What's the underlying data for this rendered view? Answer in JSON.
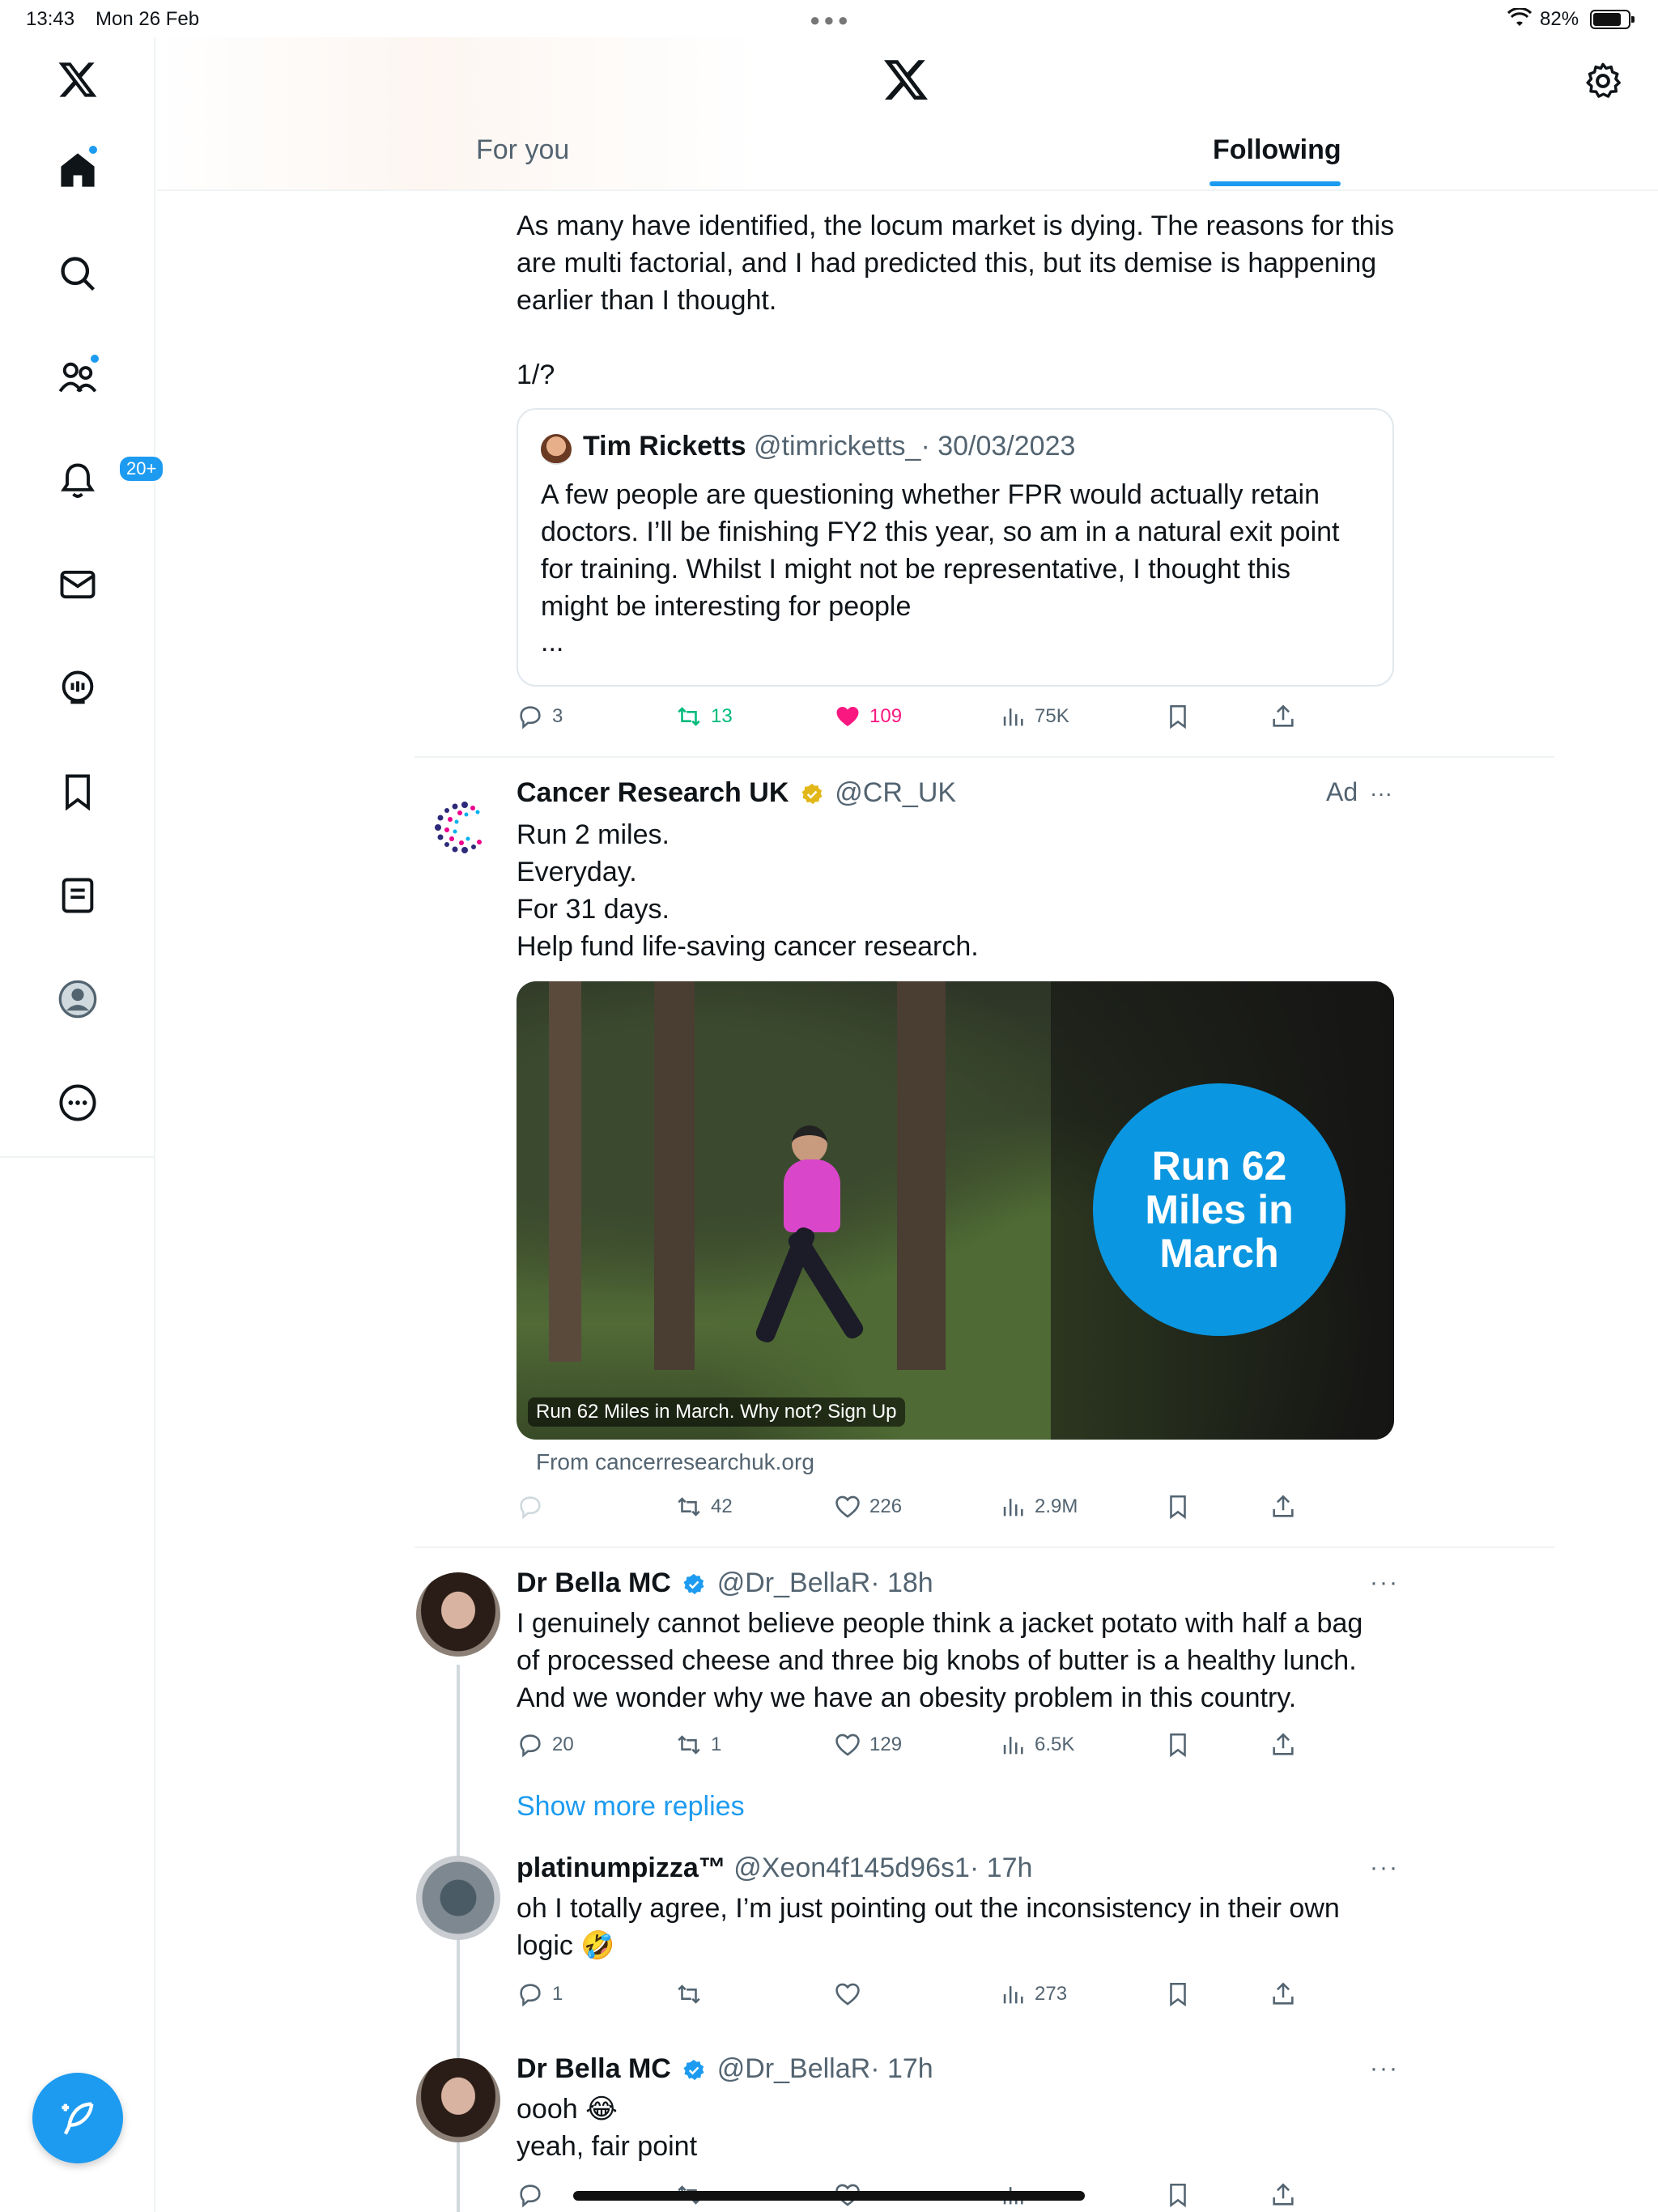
{
  "status_bar": {
    "time": "13:43",
    "date": "Mon 26 Feb",
    "battery": "82%",
    "battery_level": 0.82
  },
  "header": {
    "tabs": [
      {
        "label": "For you"
      },
      {
        "label": "Following"
      }
    ]
  },
  "sidebar": {
    "notifications_badge": "20+"
  },
  "post1": {
    "text": "As many have identified, the locum market is dying. The reasons for this\nare multi factorial, and I had predicted this, but its demise is happening\nearlier than I thought.",
    "thread_counter": "1/?",
    "quote": {
      "name": "Tim Ricketts",
      "handle": "@timricketts_",
      "date": "· 30/03/2023",
      "text": "A few people are questioning whether FPR would actually retain\ndoctors. I’ll be finishing FY2 this year, so am in a natural exit point\nfor training. Whilst I might not be representative, I thought this\nmight be interesting for people",
      "ellipsis": "..."
    },
    "stats": {
      "replies": "3",
      "reposts": "13",
      "likes": "109",
      "views": "75K"
    }
  },
  "ad": {
    "name": "Cancer Research UK",
    "handle": "@CR_UK",
    "ad_label": "Ad",
    "more": "···",
    "text": "Run 2 miles.\nEveryday.\nFor 31 days.\nHelp fund life-saving cancer research.",
    "image_headline": "Run 62\nMiles in\nMarch",
    "image_caption": "Run 62 Miles in March. Why not? Sign Up",
    "source": "From cancerresearchuk.org",
    "stats": {
      "replies": "",
      "reposts": "42",
      "likes": "226",
      "views": "2.9M"
    }
  },
  "post2": {
    "name": "Dr Bella MC",
    "handle": "@Dr_BellaR",
    "time": "· 18h",
    "more": "···",
    "text": "I genuinely cannot believe people think a jacket potato with half a bag\nof processed cheese and three big knobs of butter is a healthy lunch.\nAnd we wonder why we have an obesity problem in this country.",
    "stats": {
      "replies": "20",
      "reposts": "1",
      "likes": "129",
      "views": "6.5K"
    }
  },
  "show_more_replies": "Show more replies",
  "post3": {
    "name": "platinumpizza™",
    "handle": "@Xeon4f145d96s1",
    "time": "· 17h",
    "more": "···",
    "text": "oh I totally agree, I’m just pointing out the inconsistency in their own\nlogic 🤣",
    "stats": {
      "replies": "1",
      "reposts": "",
      "likes": "",
      "views": "273"
    }
  },
  "post4": {
    "name": "Dr Bella MC",
    "handle": "@Dr_BellaR",
    "time": "· 17h",
    "more": "···",
    "text": "oooh 😂\nyeah, fair point"
  },
  "colors": {
    "accent": "#1d9bf0",
    "repost": "#00ba7c",
    "like": "#f91880",
    "verified_gold": "#e2b719"
  }
}
